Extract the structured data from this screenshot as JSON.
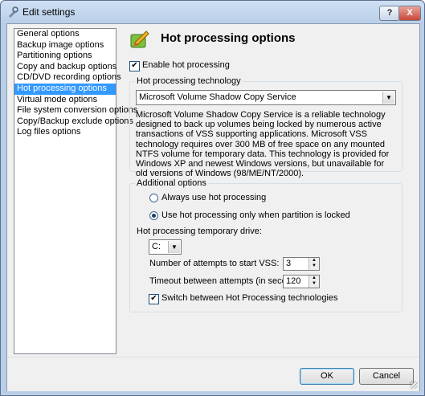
{
  "window": {
    "title": "Edit settings",
    "help_label": "?",
    "close_label": "X"
  },
  "nav": {
    "items": [
      {
        "label": "General options"
      },
      {
        "label": "Backup image options"
      },
      {
        "label": "Partitioning options"
      },
      {
        "label": "Copy and backup options"
      },
      {
        "label": "CD/DVD recording options"
      },
      {
        "label": "Hot processing options"
      },
      {
        "label": "Virtual mode options"
      },
      {
        "label": "File system conversion options"
      },
      {
        "label": "Copy/Backup exclude options"
      },
      {
        "label": "Log files options"
      }
    ],
    "selected_index": 5
  },
  "page": {
    "title": "Hot processing options",
    "icon": "hot-processing-icon",
    "enable_checkbox": {
      "label": "Enable hot processing",
      "checked": true
    },
    "technology_group": {
      "title": "Hot processing technology",
      "selected": "Microsoft Volume Shadow Copy Service",
      "description": "Microsoft Volume Shadow Copy Service is a reliable technology designed to back up volumes being locked by numerous active transactions of VSS supporting applications. Microsoft VSS technology requires over 300 MB of free space on any mounted NTFS volume for temporary data. This technology is provided for Windows XP and newest Windows versions, but unavailable for old versions of Windows (98/ME/NT/2000)."
    },
    "additional_group": {
      "title": "Additional options",
      "radio_always": {
        "label": "Always use hot processing",
        "selected": false
      },
      "radio_locked": {
        "label": "Use hot processing only when partition is locked",
        "selected": true
      },
      "temp_drive_label": "Hot processing temporary drive:",
      "temp_drive_value": "C:",
      "attempts_label": "Number of attempts to start VSS:",
      "attempts_value": "3",
      "timeout_label": "Timeout between attempts (in seconds):",
      "timeout_value": "120",
      "switch_checkbox": {
        "label": "Switch between Hot Processing technologies",
        "checked": true
      }
    }
  },
  "footer": {
    "ok_label": "OK",
    "cancel_label": "Cancel"
  }
}
